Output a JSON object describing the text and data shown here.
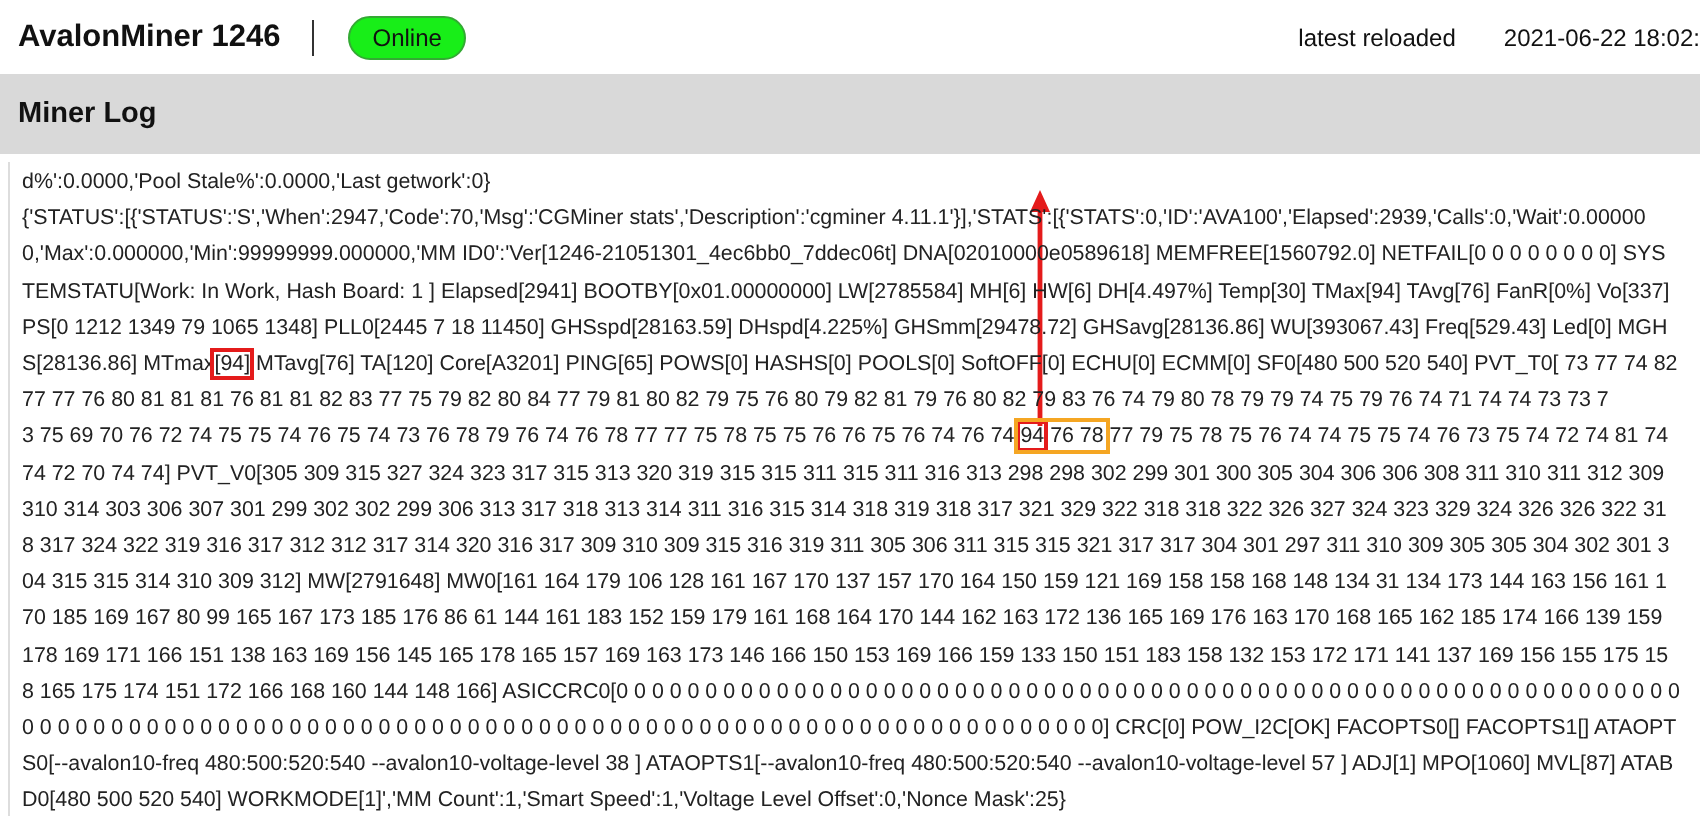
{
  "header": {
    "title": "AvalonMiner 1246",
    "status": "Online",
    "online": true,
    "reload_label": "latest reloaded",
    "reload_time": "2021-06-22 18:02:"
  },
  "section": {
    "title": "Miner Log"
  },
  "log": {
    "arrow": true,
    "lines": [
      [
        {
          "kind": "plain",
          "text": "d%':0.0000,'Pool Stale%':0.0000,'Last getwork':0}"
        }
      ],
      [
        {
          "kind": "plain",
          "text": "{'STATUS':[{'STATUS':'S','When':2947,'Code':70,'Msg':'CGMiner stats','Description':'cgminer 4.11.1'}],'STATS':[{'STATS':0,'ID':'AVA100','Elapsed':2939,'Calls':0,'Wait':0.00000"
        }
      ],
      [
        {
          "kind": "plain",
          "text": "0,'Max':0.000000,'Min':99999999.000000,'MM ID0':'Ver[1246-21051301_4ec6bb0_7ddec06t] DNA[02010000e0589618] MEMFREE[1560792.0] NETFAIL[0 0 0 0 0 0 0 0] SYS"
        }
      ],
      [
        {
          "kind": "plain",
          "text": "TEMSTATU[Work: In Work, Hash Board: 1 ] Elapsed[2941] BOOTBY[0x01.00000000] LW[2785584] MH[6] HW[6] DH[4.497%] Temp[30] TMax[94] TAvg[76] FanR[0%] Vo[337]"
        }
      ],
      [
        {
          "kind": "plain",
          "text": "PS[0 1212 1349 79 1065 1348] PLL0[2445 7 18 11450] GHSspd[28163.59] DHspd[4.225%] GHSmm[29478.72] GHSavg[28136.86] WU[393067.43] Freq[529.43] Led[0] MGH"
        }
      ],
      [
        {
          "kind": "plain",
          "text": "S[28136.86] MTmax"
        },
        {
          "kind": "red-box",
          "text": "[94]"
        },
        {
          "kind": "plain",
          "text": " MTavg[76] TA[120] Core[A3201] PING[65] POWS[0] HASHS[0] POOLS[0] SoftOFF[0] ECHU[0] ECMM[0] SF0[480 500 520 540] PVT_T0[ 73 77 74 82"
        }
      ],
      [
        {
          "kind": "plain",
          "text": "77 77 76 80 81 81 81 76 81 81 82 83 77 75 79 82 80 84 77 79 81 80 82 79 75 76 80 79 82 81 79 76 80 82 79 83 76 74 79 80 78 79 79 74 75 79 76 74 71 74 74 73 73 7"
        }
      ],
      [
        {
          "kind": "plain",
          "text": "3 75 69 70 76 72 74 75 75 74 76 75 74 73 76 78 79 76 74 76 78 77 77 75 78 75 75 76 76 75 76 74 76 74 "
        },
        {
          "kind": "orange-box",
          "parts": [
            {
              "kind": "red-box",
              "text": "94"
            },
            {
              "kind": "plain",
              "text": " 76 78"
            }
          ]
        },
        {
          "kind": "plain",
          "text": " 77 79 75 78 75 76 74 74 75 75 74 76 73 75 74 72 74 81 74"
        }
      ],
      [
        {
          "kind": "plain",
          "text": "74 72 70 74 74] PVT_V0[305 309 315 327 324 323 317 315 313 320 319 315 315 311 315 311 316 313 298 298 302 299 301 300 305 304 306 306 308 311 310 311 312 309"
        }
      ],
      [
        {
          "kind": "plain",
          "text": "310 314 303 306 307 301 299 302 302 299 306 313 317 318 313 314 311 316 315 314 318 319 318 317 321 329 322 318 318 322 326 327 324 323 329 324 326 326 322 31"
        }
      ],
      [
        {
          "kind": "plain",
          "text": "8 317 324 322 319 316 317 312 312 317 314 320 316 317 309 310 309 315 316 319 311 305 306 311 315 315 321 317 317 304 301 297 311 310 309 305 305 304 302 301 3"
        }
      ],
      [
        {
          "kind": "plain",
          "text": "04 315 315 314 310 309 312] MW[2791648] MW0[161 164 179 106 128 161 167 170 137 157 170 164 150 159 121 169 158 158 168 148 134 31 134 173 144 163 156 161 1"
        }
      ],
      [
        {
          "kind": "plain",
          "text": "70 185 169 167 80 99 165 167 173 185 176 86 61 144 161 183 152 159 179 161 168 164 170 144 162 163 172 136 165 169 176 163 170 168 165 162 185 174 166 139 159"
        }
      ],
      [
        {
          "kind": "plain",
          "text": "178 169 171 166 151 138 163 169 156 145 165 178 165 157 169 163 173 146 166 150 153 169 166 159 133 150 151 183 158 132 153 172 171 141 137 169 156 155 175 15"
        }
      ],
      [
        {
          "kind": "plain",
          "text": "8 165 175 174 151 172 166 168 160 144 148 166] ASICCRC0[0 0 0 0 0 0 0 0 0 0 0 0 0 0 0 0 0 0 0 0 0 0 0 0 0 0 0 0 0 0 0 0 0 0 0 0 0 0 0 0 0 0 0 0 0 0 0 0 0 0 0 0 0 0 0 0 0 0 0 0"
        }
      ],
      [
        {
          "kind": "plain",
          "text": "0 0 0 0 0 0 0 0 0 0 0 0 0 0 0 0 0 0 0 0 0 0 0 0 0 0 0 0 0 0 0 0 0 0 0 0 0 0 0 0 0 0 0 0 0 0 0 0 0 0 0 0 0 0 0 0 0 0 0 0 0] CRC[0] POW_I2C[OK] FACOPTS0[] FACOPTS1[] ATAOPT"
        }
      ],
      [
        {
          "kind": "plain",
          "text": "S0[--avalon10-freq 480:500:520:540 --avalon10-voltage-level 38 ] ATAOPTS1[--avalon10-freq 480:500:520:540 --avalon10-voltage-level 57 ] ADJ[1] MPO[1060] MVL[87] ATAB"
        }
      ],
      [
        {
          "kind": "plain",
          "text": "D0[480 500 520 540] WORKMODE[1]','MM Count':1,'Smart Speed':1,'Voltage Level Offset':0,'Nonce Mask':25}"
        }
      ]
    ]
  }
}
